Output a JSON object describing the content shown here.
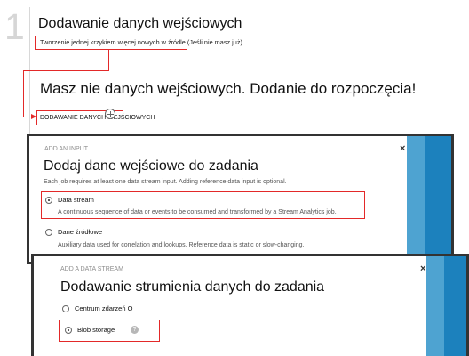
{
  "step": {
    "number": "1",
    "title": "Dodawanie danych wejściowych",
    "subtitle": "Tworzenie jednej krzykiem  więcej nowych w źródle (Jeśli  nie masz już)."
  },
  "cta": {
    "heading": "Masz nie danych wejściowych. Dodanie do rozpoczęcia!",
    "link_label": "DODAWANIE DANYCH WEJŚCIOWYCH"
  },
  "dialog_input": {
    "header_label": "ADD AN INPUT",
    "title": "Dodaj dane wejściowe do zadania",
    "description": "Each job requires at least one data stream input. Adding reference data input is optional.",
    "close_symbol": "×",
    "options": [
      {
        "label": "Data stream",
        "description": "A continuous sequence of data or events to be consumed and transformed by a Stream Analytics job.",
        "selected": true
      },
      {
        "label": "Dane źródłowe",
        "description": "Auxiliary data used for correlation and lookups. Reference data is static or slow-changing.",
        "selected": false
      }
    ]
  },
  "dialog_stream": {
    "header_label": "ADD A DATA STREAM",
    "title": "Dodawanie strumienia danych do zadania",
    "close_symbol": "×",
    "options": [
      {
        "label": "Centrum zdarzeń O",
        "selected": false
      },
      {
        "label": "Blob storage",
        "selected": true
      }
    ],
    "help_symbol": "?"
  },
  "colors": {
    "highlight": "#e32929",
    "azure_blue": "#1c81bd",
    "azure_light_blue": "#4ea3d1"
  }
}
